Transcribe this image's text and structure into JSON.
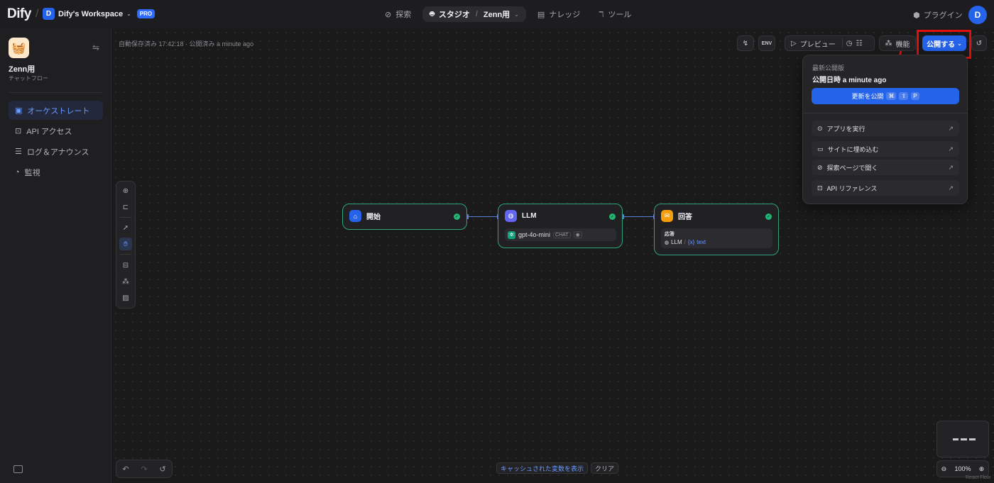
{
  "brand": {
    "logo": "Dify"
  },
  "workspace": {
    "initial": "D",
    "name": "Dify's Workspace",
    "plan": "PRO"
  },
  "nav": {
    "explore": "探索",
    "studio": "スタジオ",
    "studio_app": "Zenn用",
    "knowledge": "ナレッジ",
    "tools": "ツール",
    "plugins": "プラグイン"
  },
  "user": {
    "initial": "D"
  },
  "app": {
    "name": "Zenn用",
    "type": "チャットフロー",
    "icon": "🧺"
  },
  "sidebar": {
    "items": [
      {
        "label": "オーケストレート",
        "icon": "layout-icon",
        "active": true
      },
      {
        "label": "API アクセス",
        "icon": "terminal-icon",
        "active": false
      },
      {
        "label": "ログ＆アナウンス",
        "icon": "log-icon",
        "active": false
      },
      {
        "label": "監視",
        "icon": "monitor-icon",
        "active": false
      }
    ]
  },
  "status": {
    "autosave": "自動保存済み 17:42:18 · 公開済み a minute ago"
  },
  "toolbar": {
    "preview": "プレビュー",
    "features": "機能",
    "publish": "公開する"
  },
  "publish_menu": {
    "latest_label": "最新公開版",
    "published_at": "公開日時 a minute ago",
    "update_label": "更新を公開",
    "shortcut": [
      "⌘",
      "⇧",
      "P"
    ],
    "items": [
      {
        "label": "アプリを実行",
        "icon": "play-circle-icon"
      },
      {
        "label": "サイトに埋め込む",
        "icon": "embed-icon"
      },
      {
        "label": "探索ページで開く",
        "icon": "compass-icon"
      },
      {
        "label": "API リファレンス",
        "icon": "terminal-icon"
      }
    ]
  },
  "nodes": {
    "start": {
      "title": "開始",
      "color": "#2563eb"
    },
    "llm": {
      "title": "LLM",
      "model": "gpt-4o-mini",
      "mode": "CHAT",
      "color": "#6366f1"
    },
    "answer": {
      "title": "回答",
      "label": "応答",
      "source": "LLM",
      "var": "text",
      "color": "#f59e0b"
    }
  },
  "bottom": {
    "show_cache": "キャッシュされた変数を表示",
    "clear": "クリア",
    "zoom": "100%",
    "attribution": "React Flow"
  },
  "colors": {
    "accent": "#2563eb",
    "success": "#22b573",
    "highlight": "#e01010"
  }
}
